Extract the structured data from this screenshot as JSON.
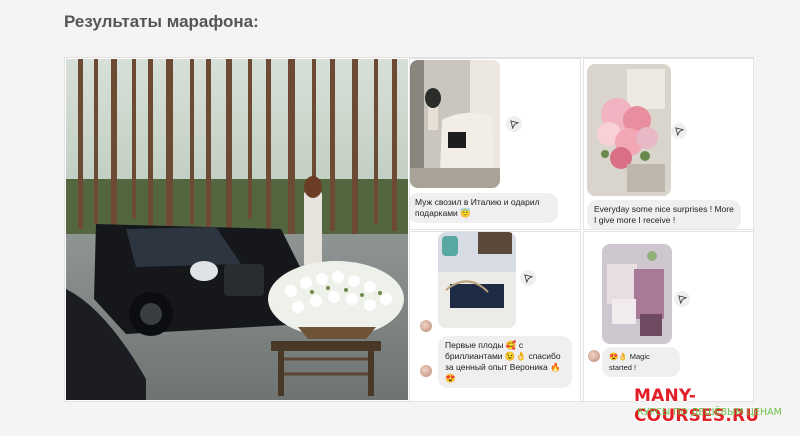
{
  "section": {
    "title": "Результаты марафона:"
  },
  "cards": [
    {
      "caption": "Муж свозил в Италию и одарил подарками 😇"
    },
    {
      "caption": "Everyday some nice surprises ! More I give more I receive !"
    },
    {
      "caption": "Первые плоды 🥰 с бриллиантами 😉👌 спасибо за ценный опыт Вероника 🔥😍"
    },
    {
      "caption": "😍👌 Magic started !"
    }
  ],
  "watermark": {
    "site": "MANY-COURSES.RU",
    "tagline": "КУРСЫ ПО ДЕШЁВЫМ ЦЕНАМ"
  },
  "icons": {
    "send": "send-icon",
    "avatar": "avatar"
  }
}
